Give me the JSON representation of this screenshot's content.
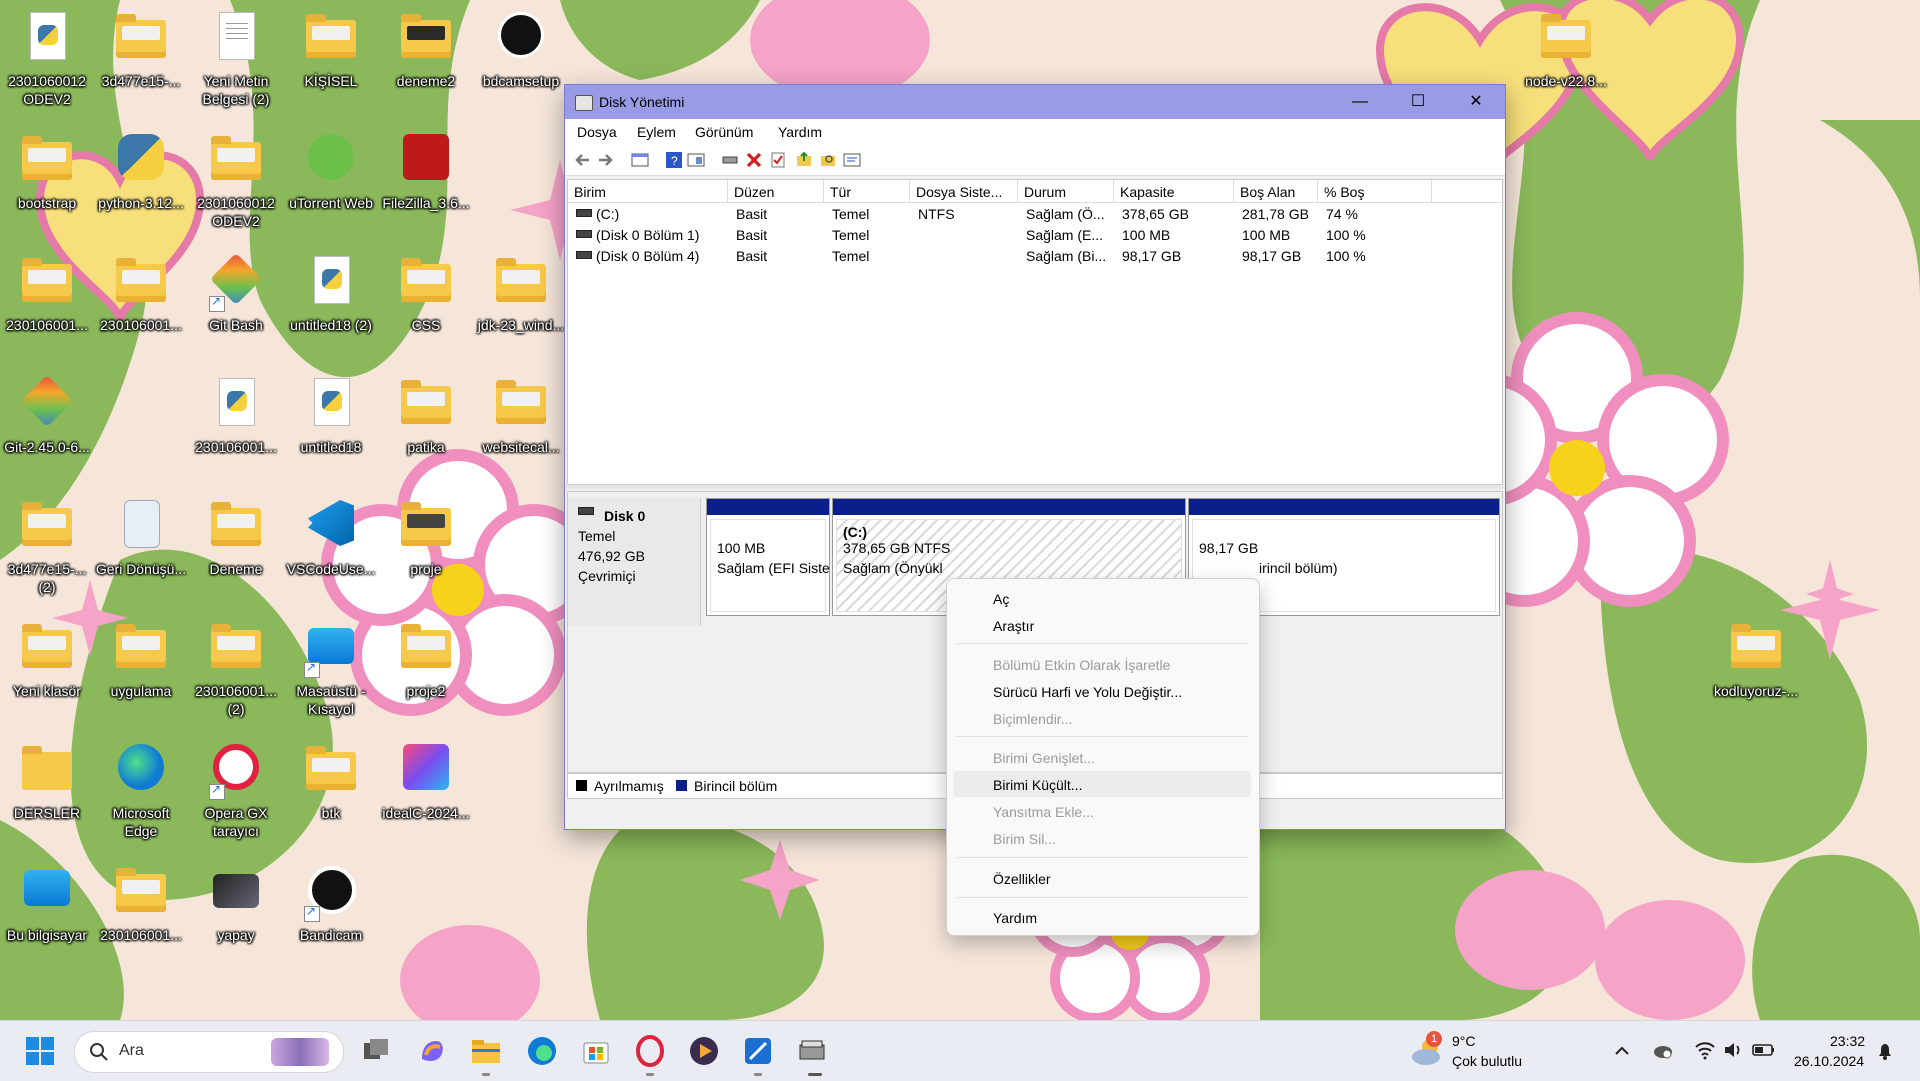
{
  "desktop": {
    "icons": [
      {
        "label": "2301060012 ODEV2"
      },
      {
        "label": "3d477e15-..."
      },
      {
        "label": "Yeni Metin Belgesi (2)"
      },
      {
        "label": "KİŞİSEL"
      },
      {
        "label": "deneme2"
      },
      {
        "label": "bdcamsetup"
      },
      {
        "label": "bootstrap"
      },
      {
        "label": "python-3.12..."
      },
      {
        "label": "2301060012 ODEV2"
      },
      {
        "label": "uTorrent Web"
      },
      {
        "label": "FileZilla_3.6..."
      },
      {
        "label": "230106001..."
      },
      {
        "label": "230106001..."
      },
      {
        "label": "Git Bash"
      },
      {
        "label": "untitled18 (2)"
      },
      {
        "label": "CSS"
      },
      {
        "label": "jdk-23_wind..."
      },
      {
        "label": "Git-2.45.0-6..."
      },
      {
        "label": "230106001..."
      },
      {
        "label": "untitled18"
      },
      {
        "label": "patika"
      },
      {
        "label": "websitecal..."
      },
      {
        "label": "3d477e15-... (2)"
      },
      {
        "label": "Geri Dönüşü..."
      },
      {
        "label": "Deneme"
      },
      {
        "label": "VSCodeUse..."
      },
      {
        "label": "proje"
      },
      {
        "label": "Yeni klasör"
      },
      {
        "label": "uygulama"
      },
      {
        "label": "230106001... (2)"
      },
      {
        "label": "Masaüstü - Kısayol"
      },
      {
        "label": "proje2"
      },
      {
        "label": "DERSLER"
      },
      {
        "label": "Microsoft Edge"
      },
      {
        "label": "Opera GX tarayıcı"
      },
      {
        "label": "btk"
      },
      {
        "label": "idealC-2024..."
      },
      {
        "label": "Bu bilgisayar"
      },
      {
        "label": "230106001..."
      },
      {
        "label": "yapay"
      },
      {
        "label": "Bandicam"
      },
      {
        "label": "node-v22.8..."
      },
      {
        "label": "kodluyoruz-..."
      }
    ]
  },
  "window": {
    "title": "Disk Yönetimi",
    "minimize": "—",
    "maximize": "☐",
    "close": "✕",
    "menu": [
      "Dosya",
      "Eylem",
      "Görünüm",
      "Yardım"
    ],
    "columns": [
      "Birim",
      "Düzen",
      "Tür",
      "Dosya Siste...",
      "Durum",
      "Kapasite",
      "Boş Alan",
      "% Boş"
    ],
    "rows": [
      {
        "birim": "(C:)",
        "duzen": "Basit",
        "tur": "Temel",
        "fs": "NTFS",
        "durum": "Sağlam (Ö...",
        "kapasite": "378,65 GB",
        "bos": "281,78 GB",
        "yuzde": "74 %"
      },
      {
        "birim": "(Disk 0 Bölüm 1)",
        "duzen": "Basit",
        "tur": "Temel",
        "fs": "",
        "durum": "Sağlam (E...",
        "kapasite": "100 MB",
        "bos": "100 MB",
        "yuzde": "100 %"
      },
      {
        "birim": "(Disk 0 Bölüm 4)",
        "duzen": "Basit",
        "tur": "Temel",
        "fs": "",
        "durum": "Sağlam (Bi...",
        "kapasite": "98,17 GB",
        "bos": "98,17 GB",
        "yuzde": "100 %"
      }
    ],
    "disk": {
      "name": "Disk 0",
      "type": "Temel",
      "size": "476,92 GB",
      "status": "Çevrimiçi",
      "partitions": [
        {
          "title": "",
          "size": "100 MB",
          "status": "Sağlam (EFI Siste"
        },
        {
          "title": "(C:)",
          "size": "378,65 GB NTFS",
          "status": "Sağlam (Önyükl"
        },
        {
          "title": "",
          "size": "98,17 GB",
          "status": "irincil bölüm)"
        }
      ]
    },
    "legend": [
      {
        "label": "Ayrılmamış",
        "color": "#000000"
      },
      {
        "label": "Birincil bölüm",
        "color": "#0a1e8c"
      }
    ]
  },
  "context_menu": {
    "items": [
      {
        "label": "Aç",
        "enabled": true
      },
      {
        "label": "Araştır",
        "enabled": true
      },
      {
        "label": "Bölümü Etkin Olarak İşaretle",
        "enabled": false
      },
      {
        "label": "Sürücü Harfi ve Yolu Değiştir...",
        "enabled": true
      },
      {
        "label": "Biçimlendir...",
        "enabled": false
      },
      {
        "label": "Birimi Genişlet...",
        "enabled": false
      },
      {
        "label": "Birimi Küçült...",
        "enabled": true,
        "hovered": true
      },
      {
        "label": "Yansıtma Ekle...",
        "enabled": false
      },
      {
        "label": "Birim Sil...",
        "enabled": false
      },
      {
        "label": "Özellikler",
        "enabled": true
      },
      {
        "label": "Yardım",
        "enabled": true
      }
    ]
  },
  "taskbar": {
    "search_label": "Ara",
    "weather_temp": "9°C",
    "weather_desc": "Çok bulutlu",
    "weather_badge": "1",
    "time": "23:32",
    "date": "26.10.2024"
  },
  "colors": {
    "titlebar": "#9a9be5",
    "primary_partition": "#0a1e8c",
    "wallpaper_green": "#8ab85a",
    "wallpaper_cream": "#f6e6da",
    "flower_pink": "#f08fbf"
  }
}
